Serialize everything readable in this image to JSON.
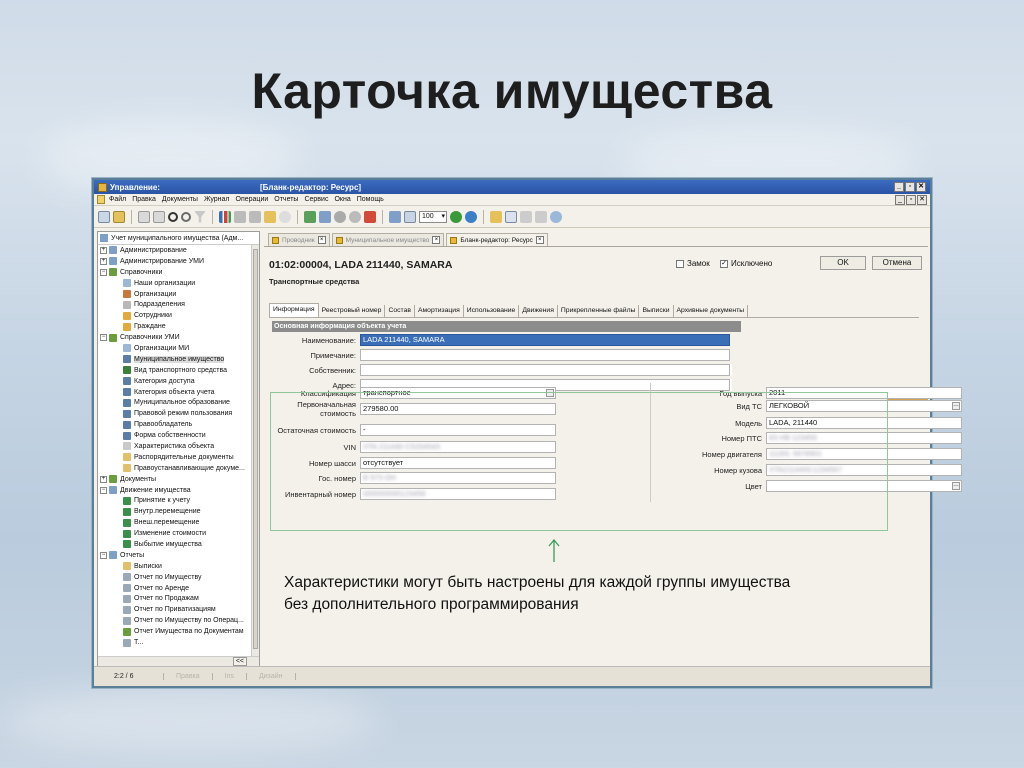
{
  "slide": {
    "title": "Карточка имущества",
    "caption_line1": "Характеристики могут быть настроены для каждой группы имущества",
    "caption_line2": "без дополнительного программирования"
  },
  "window": {
    "left_title": "Управление:",
    "title": "[Бланк-редактор: Ресурс]",
    "minimize": "_",
    "restore": "▫",
    "close": "✕"
  },
  "menu": {
    "items": [
      "Файл",
      "Правка",
      "Документы",
      "Журнал",
      "Операции",
      "Отчеты",
      "Сервис",
      "Окна",
      "Помощь"
    ]
  },
  "toolbar": {
    "zoom_value": "100"
  },
  "tree": {
    "header": "Учет муниципального имущества (Адм...",
    "collapse_label": "<<",
    "items": [
      {
        "label": "Администрирование",
        "level": 0,
        "exp": "+",
        "color": "#7da0c9"
      },
      {
        "label": "Администрирование УМИ",
        "level": 0,
        "exp": "+",
        "color": "#7da0c9"
      },
      {
        "label": "Справочники",
        "level": 0,
        "exp": "−",
        "color": "#6a9d3c"
      },
      {
        "label": "Наши организации",
        "level": 1,
        "exp": "",
        "color": "#9bb7d6"
      },
      {
        "label": "Организации",
        "level": 1,
        "exp": "",
        "color": "#c8783a"
      },
      {
        "label": "Подразделения",
        "level": 1,
        "exp": "",
        "color": "#b8b8b8"
      },
      {
        "label": "Сотрудники",
        "level": 1,
        "exp": "",
        "color": "#e2a93b"
      },
      {
        "label": "Граждане",
        "level": 1,
        "exp": "",
        "color": "#e2a93b"
      },
      {
        "label": "Справочники УМИ",
        "level": 0,
        "exp": "−",
        "color": "#6a9d3c"
      },
      {
        "label": "Организации МИ",
        "level": 1,
        "exp": "",
        "color": "#9bb7d6"
      },
      {
        "label": "Муниципальное имущество",
        "level": 1,
        "exp": "",
        "color": "#5a7ea8",
        "selected": true
      },
      {
        "label": "Вид транспортного средства",
        "level": 1,
        "exp": "",
        "color": "#3a7f3a"
      },
      {
        "label": "Категория доступа",
        "level": 1,
        "exp": "",
        "color": "#5a7ea8"
      },
      {
        "label": "Категория объекта учета",
        "level": 1,
        "exp": "",
        "color": "#5a7ea8"
      },
      {
        "label": "Муниципальное образование",
        "level": 1,
        "exp": "",
        "color": "#5a7ea8"
      },
      {
        "label": "Правовой режим пользования",
        "level": 1,
        "exp": "",
        "color": "#5a7ea8"
      },
      {
        "label": "Правообладатель",
        "level": 1,
        "exp": "",
        "color": "#5a7ea8"
      },
      {
        "label": "Форма собственности",
        "level": 1,
        "exp": "",
        "color": "#5a7ea8"
      },
      {
        "label": "Характеристика объекта",
        "level": 1,
        "exp": "",
        "color": "#c9c9c9"
      },
      {
        "label": "Распорядительные документы",
        "level": 1,
        "exp": "",
        "color": "#e2c06a"
      },
      {
        "label": "Правоустанавливающие докуме...",
        "level": 1,
        "exp": "",
        "color": "#e2c06a"
      },
      {
        "label": "Документы",
        "level": 0,
        "exp": "+",
        "color": "#6a9d3c"
      },
      {
        "label": "Движение имущества",
        "level": 0,
        "exp": "−",
        "color": "#7da0c9"
      },
      {
        "label": "Принятие к учету",
        "level": 1,
        "exp": "",
        "color": "#3a8f4a"
      },
      {
        "label": "Внутр.перемещение",
        "level": 1,
        "exp": "",
        "color": "#3a8f4a"
      },
      {
        "label": "Внеш.перемещение",
        "level": 1,
        "exp": "",
        "color": "#3a8f4a"
      },
      {
        "label": "Изменение стоимости",
        "level": 1,
        "exp": "",
        "color": "#3a8f4a"
      },
      {
        "label": "Выбытие имущества",
        "level": 1,
        "exp": "",
        "color": "#3a8f4a"
      },
      {
        "label": "Отчеты",
        "level": 0,
        "exp": "−",
        "color": "#7da0c9"
      },
      {
        "label": "Выписки",
        "level": 1,
        "exp": "",
        "color": "#e2c06a"
      },
      {
        "label": "Отчет по Имуществу",
        "level": 1,
        "exp": "",
        "color": "#9aa9b8"
      },
      {
        "label": "Отчет по Аренде",
        "level": 1,
        "exp": "",
        "color": "#9aa9b8"
      },
      {
        "label": "Отчет по Продажам",
        "level": 1,
        "exp": "",
        "color": "#9aa9b8"
      },
      {
        "label": "Отчет по Приватизациям",
        "level": 1,
        "exp": "",
        "color": "#9aa9b8"
      },
      {
        "label": "Отчет по Имуществу по Операц...",
        "level": 1,
        "exp": "",
        "color": "#9aa9b8"
      },
      {
        "label": "Отчет Имущества по Документам",
        "level": 1,
        "exp": "",
        "color": "#6a9d3c"
      },
      {
        "label": "Т...",
        "level": 1,
        "exp": "",
        "color": "#9aa9b8"
      }
    ]
  },
  "doc_tabs": [
    {
      "label": "Проводник",
      "active": false
    },
    {
      "label": "Муниципальное имущество",
      "active": false
    },
    {
      "label": "Бланк-редактор: Ресурс",
      "active": true
    }
  ],
  "card": {
    "record_title": "01:02:00004,  LADA 211440, SAMARA",
    "subtitle": "Транспортные средства",
    "lock_label": "Замок",
    "lock_checked": "",
    "excluded_label": "Исключено",
    "excluded_checked": "✓",
    "ok_label": "OK",
    "cancel_label": "Отмена"
  },
  "prop_tabs": [
    "Информация",
    "Реестровый номер",
    "Состав",
    "Амортизация",
    "Использование",
    "Движения",
    "Прикрепленные файлы",
    "Выписки",
    "Архивные документы"
  ],
  "main_info": {
    "section_label": "Основная информация объекта учета",
    "name_label": "Наименование:",
    "name_value": "LADA 211440, SAMARA",
    "note_label": "Примечание:",
    "note_value": "",
    "owner_label": "Собственник:",
    "owner_value": "",
    "address_label": "Адрес:",
    "address_value": ""
  },
  "characteristics": {
    "left": [
      {
        "label": "Классификация",
        "value": "транспортное",
        "dropdown": true
      },
      {
        "label": "Первоначальная стоимость",
        "value": "279580.00"
      },
      {
        "label": "Остаточная стоимость",
        "value": "-"
      },
      {
        "label": "VIN",
        "value": "XTA 211440 C5204543",
        "blurred": true
      },
      {
        "label": "Номер шасси",
        "value": "отсутствует"
      },
      {
        "label": "Гос. номер",
        "value": "В 573 ОН",
        "blurred": true
      },
      {
        "label": "Инвентарный номер",
        "value": "000000000123456",
        "blurred": true
      }
    ],
    "right": [
      {
        "label": "Год выпуска",
        "value": "2011"
      },
      {
        "label": "Вид ТС",
        "value": "ЛЕГКОВОЙ",
        "dropdown": true
      },
      {
        "label": "Модель",
        "value": "LADA, 211440"
      },
      {
        "label": "Номер ПТС",
        "value": "63 НВ 123456",
        "blurred": true
      },
      {
        "label": "Номер двигателя",
        "value": "11183, 5678901",
        "blurred": true
      },
      {
        "label": "Номер кузова",
        "value": "XTA211440C1234567",
        "blurred": true
      },
      {
        "label": "Цвет",
        "value": "",
        "dropdown": true
      }
    ]
  },
  "statusbar": {
    "position": "2:2 / 6",
    "cells": [
      "Правка",
      "Ins",
      "Дизайн"
    ]
  },
  "colors": {
    "title_bar": "#2a54a6",
    "highlight": "#3a6fb8",
    "frame": "#8fc79a",
    "section_bar": "#8c8c8c",
    "arrow": "#3a9a5a"
  }
}
